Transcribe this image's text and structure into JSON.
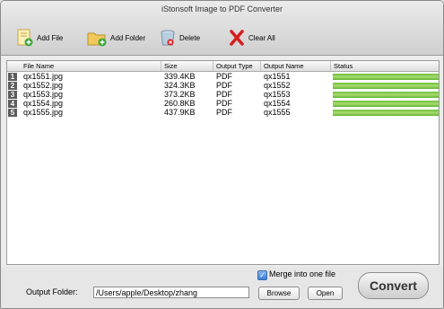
{
  "window": {
    "title": "iStonsoft Image to PDF Converter"
  },
  "toolbar": {
    "add_file": "Add File",
    "add_folder": "Add Folder",
    "delete": "Delete",
    "clear_all": "Clear All"
  },
  "table": {
    "columns": [
      "File Name",
      "Size",
      "Output Type",
      "Output Name",
      "Status"
    ],
    "rows": [
      {
        "num": "1",
        "file": "qx1551.jpg",
        "size": "339.4KB",
        "type": "PDF",
        "output": "qx1551",
        "progress": 1.0
      },
      {
        "num": "2",
        "file": "qx1552.jpg",
        "size": "324.3KB",
        "type": "PDF",
        "output": "qx1552",
        "progress": 1.0
      },
      {
        "num": "3",
        "file": "qx1553.jpg",
        "size": "373.2KB",
        "type": "PDF",
        "output": "qx1553",
        "progress": 1.0
      },
      {
        "num": "4",
        "file": "qx1554.jpg",
        "size": "260.8KB",
        "type": "PDF",
        "output": "qx1554",
        "progress": 1.0
      },
      {
        "num": "5",
        "file": "qx1555.jpg",
        "size": "437.9KB",
        "type": "PDF",
        "output": "qx1555",
        "progress": 1.0
      }
    ]
  },
  "bottom": {
    "merge_label": "Merge into one file",
    "merge_checked": true,
    "output_folder_label": "Output Folder:",
    "output_folder_value": "/Users/apple/Desktop/zhang",
    "browse": "Browse",
    "open": "Open",
    "convert": "Convert"
  },
  "colors": {
    "progress": "#7cc846",
    "row_number_bg": "#5d5d5d",
    "delete_x": "#d71e1e"
  }
}
